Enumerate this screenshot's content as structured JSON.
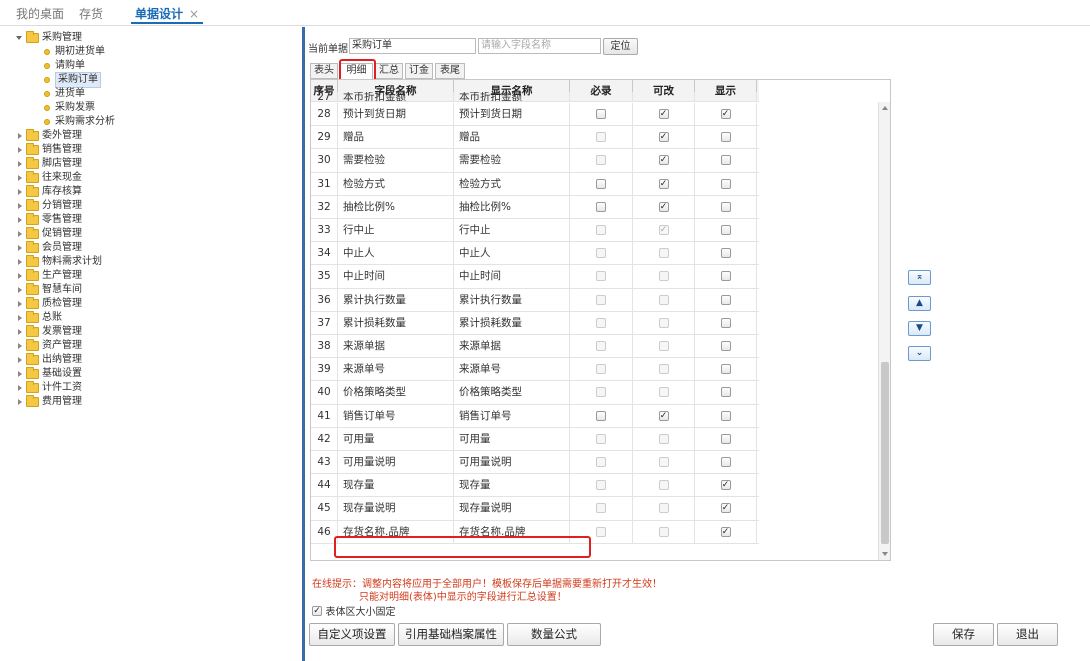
{
  "tabs": [
    {
      "label": "我的桌面"
    },
    {
      "label": "存货"
    },
    {
      "label": "单据设计",
      "close": "×"
    }
  ],
  "tree": {
    "root": "采购管理",
    "children": [
      "期初进货单",
      "请购单",
      "采购订单",
      "进货单",
      "采购发票",
      "采购需求分析"
    ],
    "selected": "采购订单",
    "groups": [
      "委外管理",
      "销售管理",
      "脚店管理",
      "往来现金",
      "库存核算",
      "分销管理",
      "零售管理",
      "促销管理",
      "会员管理",
      "物料需求计划",
      "生产管理",
      "智慧车间",
      "质检管理",
      "总账",
      "发票管理",
      "资产管理",
      "出纳管理",
      "基础设置",
      "计件工资",
      "费用管理"
    ]
  },
  "form": {
    "current_label": "当前单据",
    "current_value": "采购订单",
    "search_placeholder": "请输入字段名称",
    "locate_button": "定位"
  },
  "subtabs": [
    "表头",
    "明细",
    "汇总",
    "订金",
    "表尾"
  ],
  "active_subtab": "明细",
  "grid": {
    "headers": [
      "序号",
      "字段名称",
      "显示名称",
      "必录",
      "可改",
      "显示"
    ],
    "partial_row": {
      "no": "27",
      "field": "本币折扣金额",
      "display": "本币折扣金额"
    },
    "rows": [
      {
        "no": "28",
        "field": "预计到货日期",
        "display": "预计到货日期",
        "req": false,
        "req_dis": false,
        "edit": true,
        "edit_dis": false,
        "show": true,
        "show_dis": false
      },
      {
        "no": "29",
        "field": "赠品",
        "display": "赠品",
        "req": false,
        "req_dis": true,
        "edit": true,
        "edit_dis": false,
        "show": false,
        "show_dis": false
      },
      {
        "no": "30",
        "field": "需要检验",
        "display": "需要检验",
        "req": false,
        "req_dis": true,
        "edit": true,
        "edit_dis": false,
        "show": false,
        "show_dis": false
      },
      {
        "no": "31",
        "field": "检验方式",
        "display": "检验方式",
        "req": false,
        "req_dis": false,
        "edit": true,
        "edit_dis": false,
        "show": false,
        "show_dis": false
      },
      {
        "no": "32",
        "field": "抽检比例%",
        "display": "抽检比例%",
        "req": false,
        "req_dis": false,
        "edit": true,
        "edit_dis": false,
        "show": false,
        "show_dis": false
      },
      {
        "no": "33",
        "field": "行中止",
        "display": "行中止",
        "req": false,
        "req_dis": true,
        "edit": true,
        "edit_dis": true,
        "show": false,
        "show_dis": false
      },
      {
        "no": "34",
        "field": "中止人",
        "display": "中止人",
        "req": false,
        "req_dis": true,
        "edit": false,
        "edit_dis": true,
        "show": false,
        "show_dis": false
      },
      {
        "no": "35",
        "field": "中止时间",
        "display": "中止时间",
        "req": false,
        "req_dis": true,
        "edit": false,
        "edit_dis": true,
        "show": false,
        "show_dis": false
      },
      {
        "no": "36",
        "field": "累计执行数量",
        "display": "累计执行数量",
        "req": false,
        "req_dis": true,
        "edit": false,
        "edit_dis": true,
        "show": false,
        "show_dis": false
      },
      {
        "no": "37",
        "field": "累计损耗数量",
        "display": "累计损耗数量",
        "req": false,
        "req_dis": true,
        "edit": false,
        "edit_dis": true,
        "show": false,
        "show_dis": false
      },
      {
        "no": "38",
        "field": "来源单据",
        "display": "来源单据",
        "req": false,
        "req_dis": true,
        "edit": false,
        "edit_dis": true,
        "show": false,
        "show_dis": false
      },
      {
        "no": "39",
        "field": "来源单号",
        "display": "来源单号",
        "req": false,
        "req_dis": true,
        "edit": false,
        "edit_dis": true,
        "show": false,
        "show_dis": false
      },
      {
        "no": "40",
        "field": "价格策略类型",
        "display": "价格策略类型",
        "req": false,
        "req_dis": true,
        "edit": false,
        "edit_dis": true,
        "show": false,
        "show_dis": false
      },
      {
        "no": "41",
        "field": "销售订单号",
        "display": "销售订单号",
        "req": false,
        "req_dis": false,
        "edit": true,
        "edit_dis": false,
        "show": false,
        "show_dis": false
      },
      {
        "no": "42",
        "field": "可用量",
        "display": "可用量",
        "req": false,
        "req_dis": true,
        "edit": false,
        "edit_dis": true,
        "show": false,
        "show_dis": false
      },
      {
        "no": "43",
        "field": "可用量说明",
        "display": "可用量说明",
        "req": false,
        "req_dis": true,
        "edit": false,
        "edit_dis": true,
        "show": false,
        "show_dis": false
      },
      {
        "no": "44",
        "field": "现存量",
        "display": "现存量",
        "req": false,
        "req_dis": true,
        "edit": false,
        "edit_dis": true,
        "show": true,
        "show_dis": false
      },
      {
        "no": "45",
        "field": "现存量说明",
        "display": "现存量说明",
        "req": false,
        "req_dis": true,
        "edit": false,
        "edit_dis": true,
        "show": true,
        "show_dis": false
      },
      {
        "no": "46",
        "field": "存货名称.品牌",
        "display": "存货名称.品牌",
        "req": false,
        "req_dis": true,
        "edit": false,
        "edit_dis": true,
        "show": true,
        "show_dis": false
      }
    ]
  },
  "move_buttons": [
    {
      "icon": "move-top-icon",
      "glyph": "⌅"
    },
    {
      "icon": "move-up-icon",
      "glyph": "▲"
    },
    {
      "icon": "move-down-icon",
      "glyph": "▼"
    },
    {
      "icon": "move-bottom-icon",
      "glyph": "⌄"
    }
  ],
  "hints": {
    "line1": "在线提示：调整内容将应用于全部用户！模板保存后单据需要重新打开才生效！",
    "line2": "只能对明细(表体)中显示的字段进行汇总设置！"
  },
  "fixed_size": {
    "label": "表体区大小固定",
    "checked": true
  },
  "buttons": {
    "custom": "自定义项设置",
    "ref_attr": "引用基础档案属性",
    "qty_formula": "数量公式",
    "save": "保存",
    "exit": "退出"
  },
  "colors": {
    "accent": "#1a6bb8",
    "highlight": "#e02020",
    "hint": "#d23c1c",
    "divider": "#3a6aa8"
  }
}
